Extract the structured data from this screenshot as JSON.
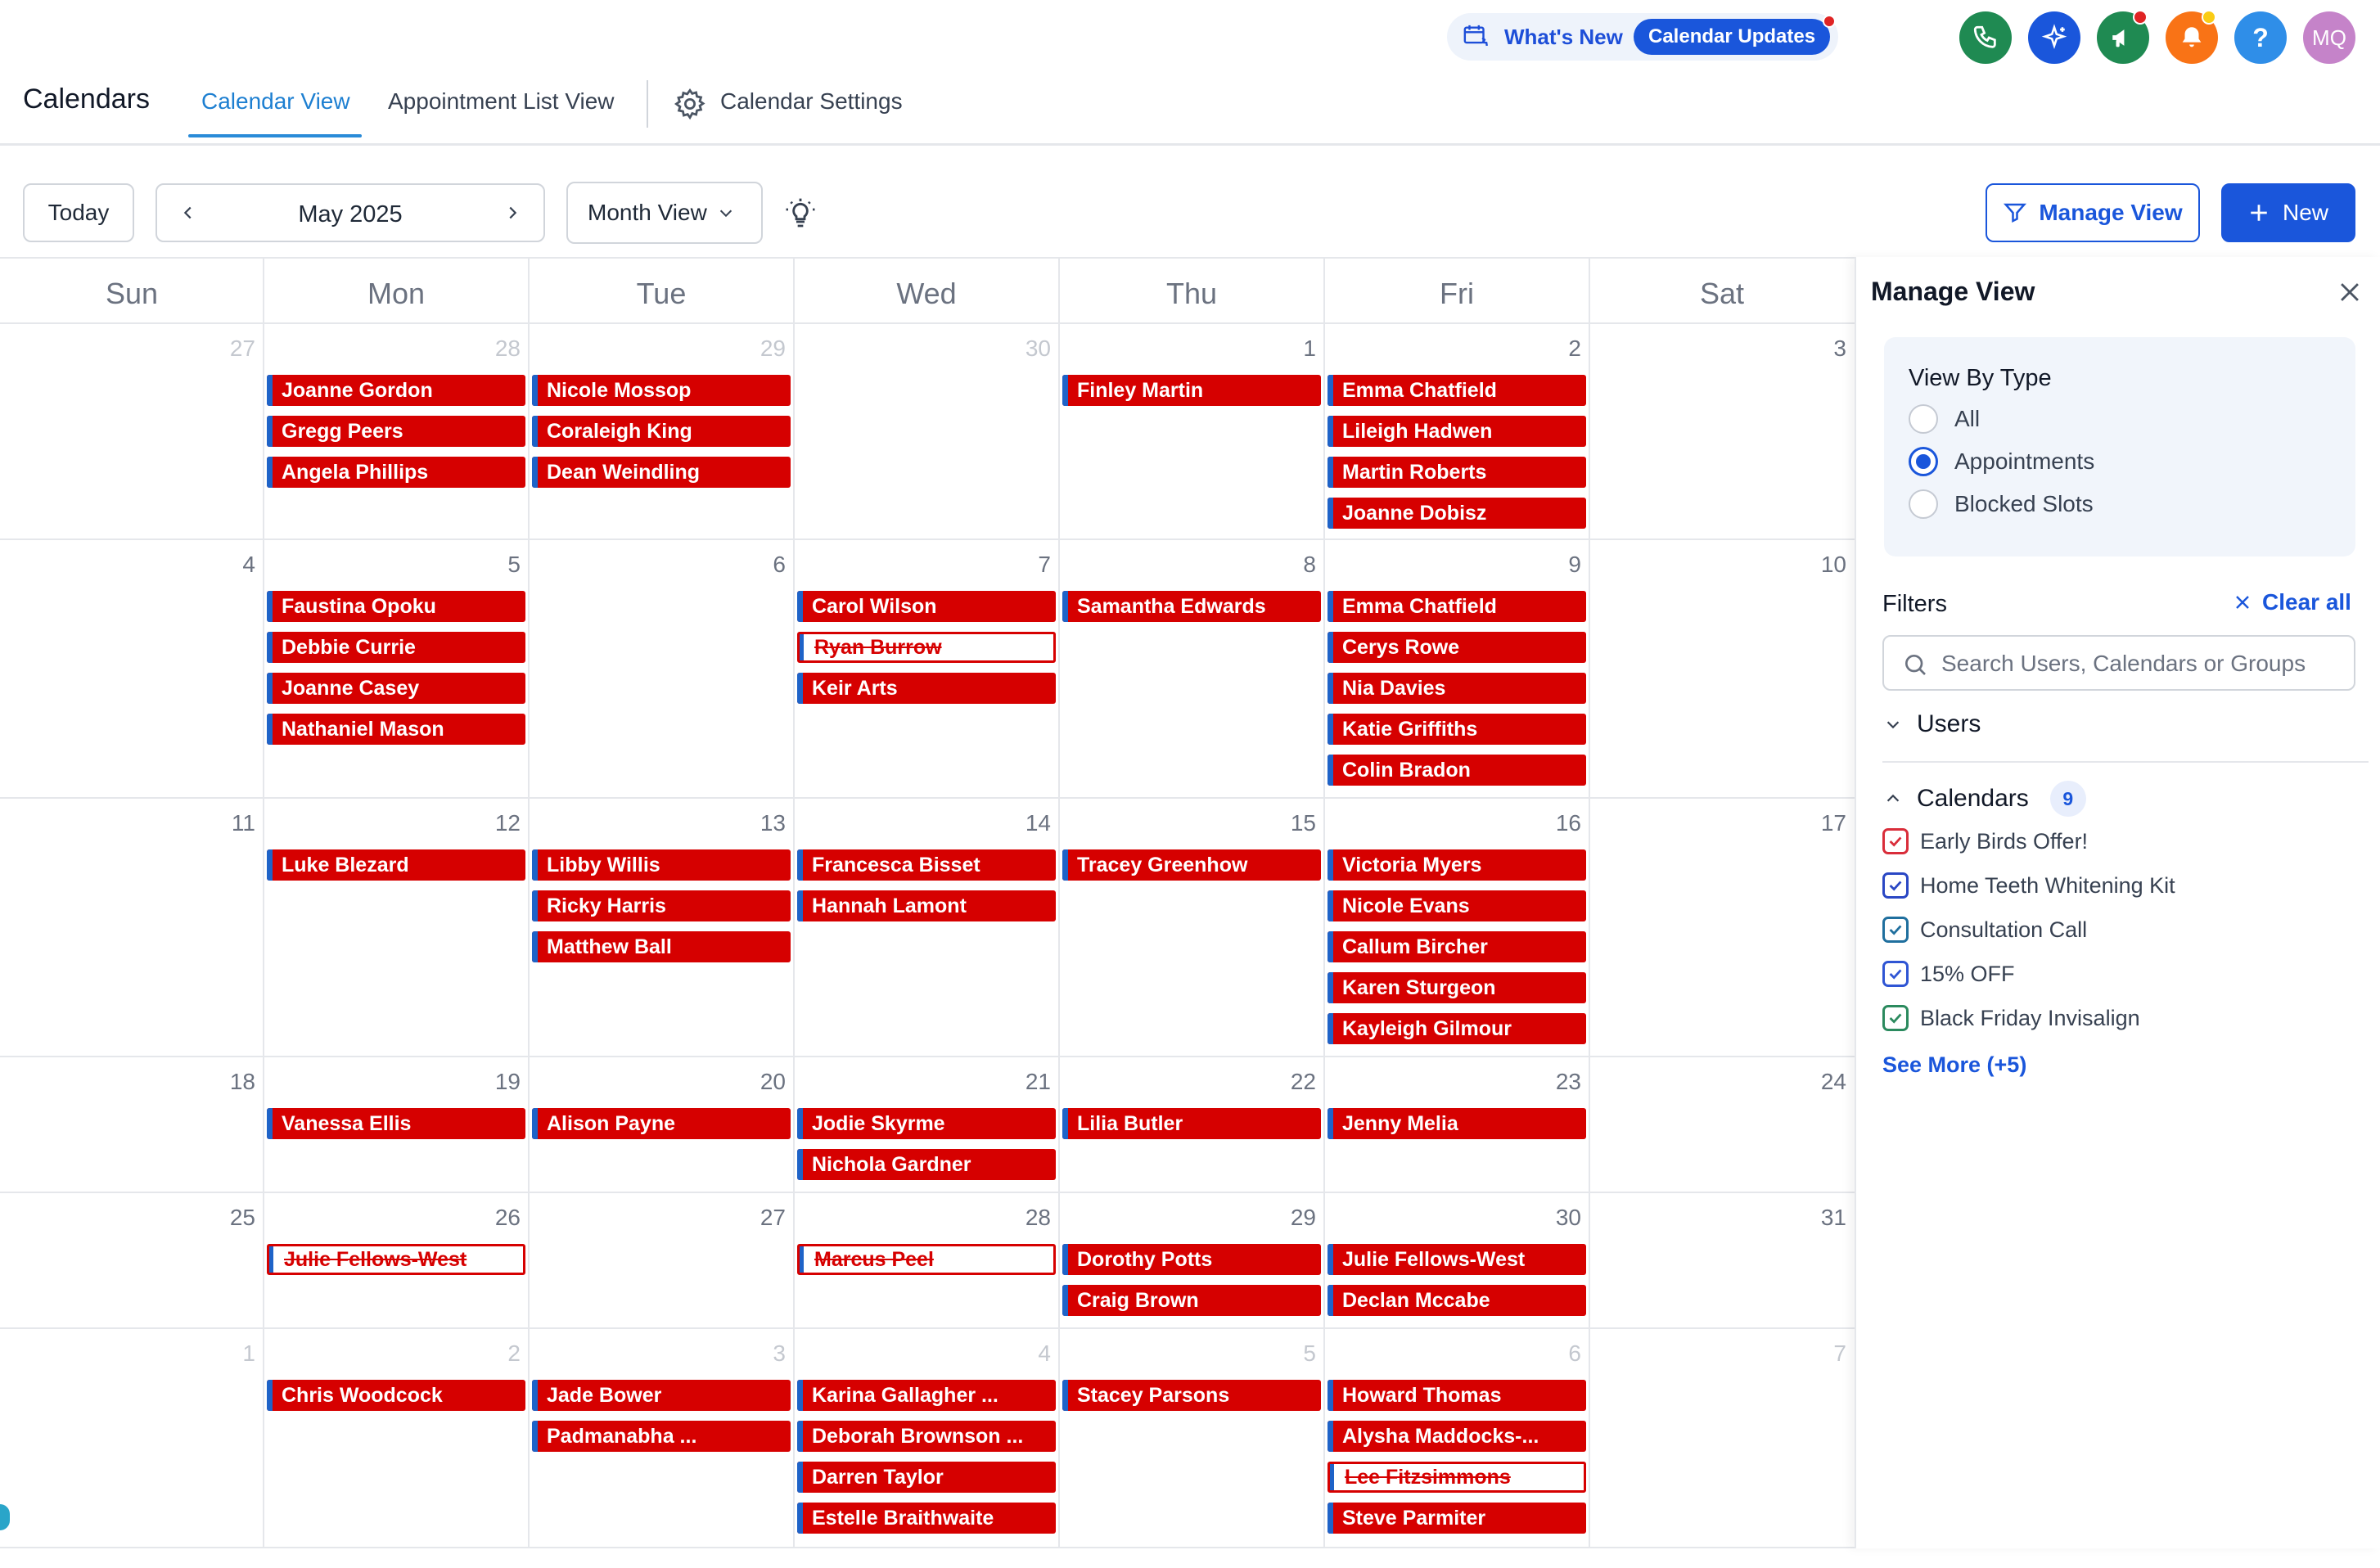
{
  "header": {
    "title": "Calendars",
    "tabs": [
      "Calendar View",
      "Appointment List View"
    ],
    "settings_label": "Calendar Settings",
    "whats_new": "What's New",
    "updates_pill": "Calendar Updates",
    "avatar_initials": "MQ"
  },
  "toolbar": {
    "today": "Today",
    "month": "May 2025",
    "view_select": "Month View",
    "manage_view": "Manage View",
    "new": "New"
  },
  "calendar": {
    "weekdays": [
      "Sun",
      "Mon",
      "Tue",
      "Wed",
      "Thu",
      "Fri",
      "Sat"
    ],
    "weeks": [
      {
        "days": [
          {
            "num": "27",
            "other": true,
            "events": []
          },
          {
            "num": "28",
            "other": true,
            "events": [
              {
                "name": "Joanne  Gordon"
              },
              {
                "name": "Gregg Peers"
              },
              {
                "name": "Angela  Phillips"
              }
            ]
          },
          {
            "num": "29",
            "other": true,
            "events": [
              {
                "name": "Nicole Mossop"
              },
              {
                "name": "Coraleigh King"
              },
              {
                "name": "Dean Weindling"
              }
            ]
          },
          {
            "num": "30",
            "other": true,
            "events": []
          },
          {
            "num": "1",
            "other": false,
            "events": [
              {
                "name": "Finley Martin"
              }
            ]
          },
          {
            "num": "2",
            "other": false,
            "events": [
              {
                "name": "Emma Chatfield"
              },
              {
                "name": "Lileigh Hadwen"
              },
              {
                "name": "Martin  Roberts"
              },
              {
                "name": "Joanne Dobisz"
              }
            ]
          },
          {
            "num": "3",
            "other": false,
            "events": []
          }
        ]
      },
      {
        "days": [
          {
            "num": "4",
            "other": false,
            "events": []
          },
          {
            "num": "5",
            "other": false,
            "events": [
              {
                "name": "Faustina  Opoku"
              },
              {
                "name": "Debbie Currie"
              },
              {
                "name": "Joanne Casey"
              },
              {
                "name": "Nathaniel Mason"
              }
            ]
          },
          {
            "num": "6",
            "other": false,
            "events": []
          },
          {
            "num": "7",
            "other": false,
            "events": [
              {
                "name": "Carol Wilson"
              },
              {
                "name": "Ryan Burrow",
                "cancelled": true
              },
              {
                "name": "Keir Arts"
              }
            ]
          },
          {
            "num": "8",
            "other": false,
            "events": [
              {
                "name": "Samantha Edwards"
              }
            ]
          },
          {
            "num": "9",
            "other": false,
            "events": [
              {
                "name": "Emma Chatfield"
              },
              {
                "name": "Cerys Rowe"
              },
              {
                "name": "Nia Davies"
              },
              {
                "name": "Katie Griffiths"
              },
              {
                "name": "Colin Bradon"
              }
            ]
          },
          {
            "num": "10",
            "other": false,
            "events": []
          }
        ]
      },
      {
        "days": [
          {
            "num": "11",
            "other": false,
            "events": []
          },
          {
            "num": "12",
            "other": false,
            "events": [
              {
                "name": "Luke Blezard"
              }
            ]
          },
          {
            "num": "13",
            "other": false,
            "events": [
              {
                "name": "Libby  Willis"
              },
              {
                "name": "Ricky  Harris"
              },
              {
                "name": "Matthew Ball"
              }
            ]
          },
          {
            "num": "14",
            "other": false,
            "events": [
              {
                "name": "Francesca Bisset"
              },
              {
                "name": "Hannah Lamont"
              }
            ]
          },
          {
            "num": "15",
            "other": false,
            "events": [
              {
                "name": "Tracey Greenhow"
              }
            ]
          },
          {
            "num": "16",
            "other": false,
            "events": [
              {
                "name": "Victoria Myers"
              },
              {
                "name": "Nicole Evans"
              },
              {
                "name": "Callum  Bircher"
              },
              {
                "name": "Karen Sturgeon"
              },
              {
                "name": "Kayleigh Gilmour"
              }
            ]
          },
          {
            "num": "17",
            "other": false,
            "events": []
          }
        ]
      },
      {
        "days": [
          {
            "num": "18",
            "other": false,
            "events": []
          },
          {
            "num": "19",
            "other": false,
            "events": [
              {
                "name": "Vanessa Ellis"
              }
            ]
          },
          {
            "num": "20",
            "other": false,
            "events": [
              {
                "name": "Alison Payne"
              }
            ]
          },
          {
            "num": "21",
            "other": false,
            "events": [
              {
                "name": "Jodie Skyrme"
              },
              {
                "name": "Nichola Gardner"
              }
            ]
          },
          {
            "num": "22",
            "other": false,
            "events": [
              {
                "name": "Lilia Butler"
              }
            ]
          },
          {
            "num": "23",
            "other": false,
            "events": [
              {
                "name": "Jenny Melia"
              }
            ]
          },
          {
            "num": "24",
            "other": false,
            "events": []
          }
        ]
      },
      {
        "days": [
          {
            "num": "25",
            "other": false,
            "events": []
          },
          {
            "num": "26",
            "other": false,
            "events": [
              {
                "name": "Julie Fellows-West ",
                "cancelled": true
              }
            ]
          },
          {
            "num": "27",
            "other": false,
            "events": []
          },
          {
            "num": "28",
            "other": false,
            "events": [
              {
                "name": "Marcus Peel",
                "cancelled": true
              }
            ]
          },
          {
            "num": "29",
            "other": false,
            "events": [
              {
                "name": "Dorothy Potts"
              },
              {
                "name": "Craig  Brown"
              }
            ]
          },
          {
            "num": "30",
            "other": false,
            "events": [
              {
                "name": "Julie Fellows-West"
              },
              {
                "name": "Declan Mccabe"
              }
            ]
          },
          {
            "num": "31",
            "other": false,
            "events": []
          }
        ]
      },
      {
        "days": [
          {
            "num": "1",
            "other": true,
            "events": []
          },
          {
            "num": "2",
            "other": true,
            "events": [
              {
                "name": "Chris Woodcock"
              }
            ]
          },
          {
            "num": "3",
            "other": true,
            "events": [
              {
                "name": "Jade Bower"
              },
              {
                "name": "Padmanabha ..."
              }
            ]
          },
          {
            "num": "4",
            "other": true,
            "events": [
              {
                "name": "Karina Gallagher ..."
              },
              {
                "name": "Deborah Brownson ..."
              },
              {
                "name": "Darren Taylor"
              },
              {
                "name": "Estelle Braithwaite"
              }
            ]
          },
          {
            "num": "5",
            "other": true,
            "events": [
              {
                "name": "Stacey Parsons"
              }
            ]
          },
          {
            "num": "6",
            "other": true,
            "events": [
              {
                "name": "Howard Thomas"
              },
              {
                "name": "Alysha Maddocks-..."
              },
              {
                "name": "Lee Fitzsimmons ",
                "cancelled": true
              },
              {
                "name": "Steve Parmiter"
              }
            ]
          },
          {
            "num": "7",
            "other": true,
            "events": []
          }
        ]
      }
    ]
  },
  "panel": {
    "title": "Manage View",
    "view_by_type": {
      "title": "View By Type",
      "options": [
        {
          "label": "All",
          "selected": false
        },
        {
          "label": "Appointments",
          "selected": true
        },
        {
          "label": "Blocked Slots",
          "selected": false
        }
      ]
    },
    "filters_label": "Filters",
    "clear_all": "Clear all",
    "search_placeholder": "Search Users, Calendars or Groups",
    "users_label": "Users",
    "calendars_label": "Calendars",
    "calendars_count": "9",
    "calendars": [
      {
        "label": "Early Birds Offer!",
        "color": "#d92d3a"
      },
      {
        "label": "Home Teeth Whitening Kit",
        "color": "#2a47c4"
      },
      {
        "label": "Consultation Call",
        "color": "#1f6f9e"
      },
      {
        "label": "15% OFF",
        "color": "#2f55d4"
      },
      {
        "label": "Black Friday Invisalign",
        "color": "#2b8a5e"
      }
    ],
    "see_more": "See More (+5)"
  },
  "colors": {
    "primary": "#1a56db",
    "event": "#d60000",
    "event_stripe": "#1e63c8",
    "phone": "#1f8a52",
    "sparkle": "#1a56db",
    "megaphone": "#1f8a52",
    "bell": "#f97316",
    "help": "#2f8ee8",
    "avatar": "#c583c9"
  }
}
